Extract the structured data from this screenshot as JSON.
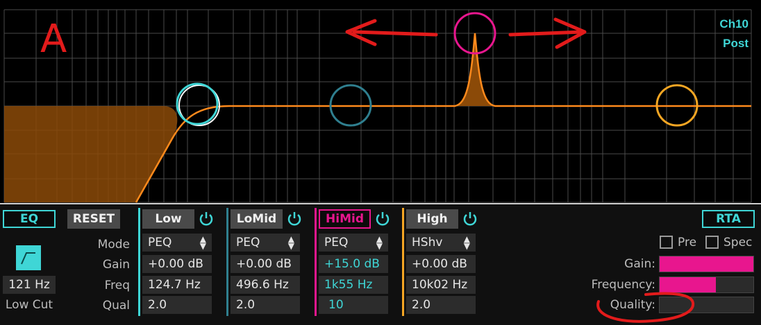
{
  "display": {
    "channel": "Ch10",
    "tap": "Post"
  },
  "left": {
    "eq_label": "EQ",
    "reset_label": "RESET",
    "lowcut_freq": "121 Hz",
    "lowcut_label": "Low Cut"
  },
  "row_labels": {
    "mode": "Mode",
    "gain": "Gain",
    "freq": "Freq",
    "qual": "Qual"
  },
  "bands": [
    {
      "name": "Low",
      "mode": "PEQ",
      "gain": "+0.00 dB",
      "freq": "124.7 Hz",
      "qual": "2.0",
      "color": "#3fd6d6"
    },
    {
      "name": "LoMid",
      "mode": "PEQ",
      "gain": "+0.00 dB",
      "freq": "496.6 Hz",
      "qual": "2.0",
      "color": "#3fa0b0"
    },
    {
      "name": "HiMid",
      "mode": "PEQ",
      "gain": "+15.0 dB",
      "freq": "1k55 Hz",
      "qual": "10",
      "color": "#e8168e"
    },
    {
      "name": "High",
      "mode": "HShv",
      "gain": "+0.00 dB",
      "freq": "10k02 Hz",
      "qual": "2.0",
      "color": "#f5a623"
    }
  ],
  "rta": {
    "label": "RTA",
    "pre_label": "Pre",
    "spec_label": "Spec",
    "gain_label": "Gain:",
    "freq_label": "Frequency:",
    "qual_label": "Quality:",
    "gain_level": 1.0,
    "freq_level": 0.6,
    "qual_level": 0.0
  },
  "annotation": {
    "letter": "A"
  }
}
